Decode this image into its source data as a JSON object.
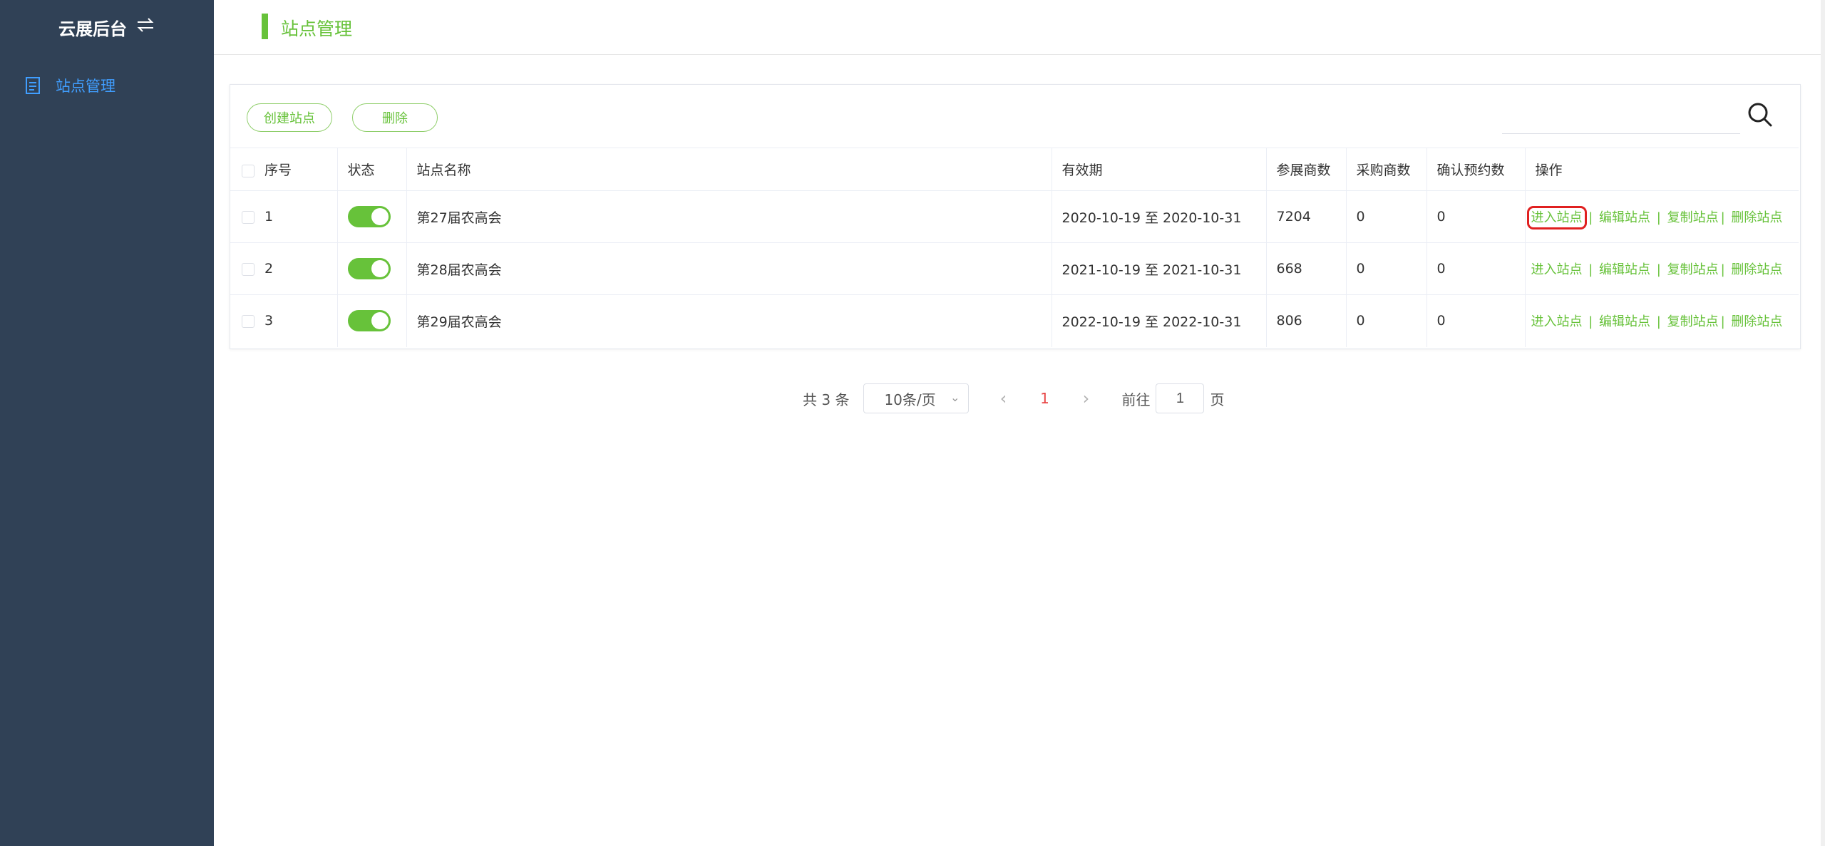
{
  "sidebar": {
    "brand": "云展后台",
    "brand_icon": "swap-icon",
    "items": [
      {
        "label": "站点管理",
        "icon": "document-icon"
      }
    ]
  },
  "header": {
    "title": "站点管理"
  },
  "toolbar": {
    "create_label": "创建站点",
    "delete_label": "删除",
    "search_value": "",
    "search_icon": "search-icon"
  },
  "table": {
    "columns": [
      "序号",
      "状态",
      "站点名称",
      "有效期",
      "参展商数",
      "采购商数",
      "确认预约数",
      "操作"
    ],
    "rows": [
      {
        "index": "1",
        "status": true,
        "name": "第27届农高会",
        "period": "2020-10-19 至 2020-10-31",
        "exhibitors": "7204",
        "buyers": "0",
        "appointments": "0"
      },
      {
        "index": "2",
        "status": true,
        "name": "第28届农高会",
        "period": "2021-10-19 至 2021-10-31",
        "exhibitors": "668",
        "buyers": "0",
        "appointments": "0"
      },
      {
        "index": "3",
        "status": true,
        "name": "第29届农高会",
        "period": "2022-10-19 至 2022-10-31",
        "exhibitors": "806",
        "buyers": "0",
        "appointments": "0"
      }
    ],
    "actions": {
      "enter": "进入站点",
      "edit": "编辑站点",
      "copy": "复制站点",
      "remove": "删除站点",
      "sep": "|"
    }
  },
  "pagination": {
    "total": "共 3 条",
    "page_size": "10条/页",
    "current_page": "1",
    "goto_label": "前往",
    "goto_value": "1",
    "unit": "页"
  },
  "colors": {
    "sidebar_bg": "#304156",
    "accent": "#67c23a",
    "nav_active": "#409eff",
    "current_page": "#e84545",
    "highlight": "#e02020"
  }
}
